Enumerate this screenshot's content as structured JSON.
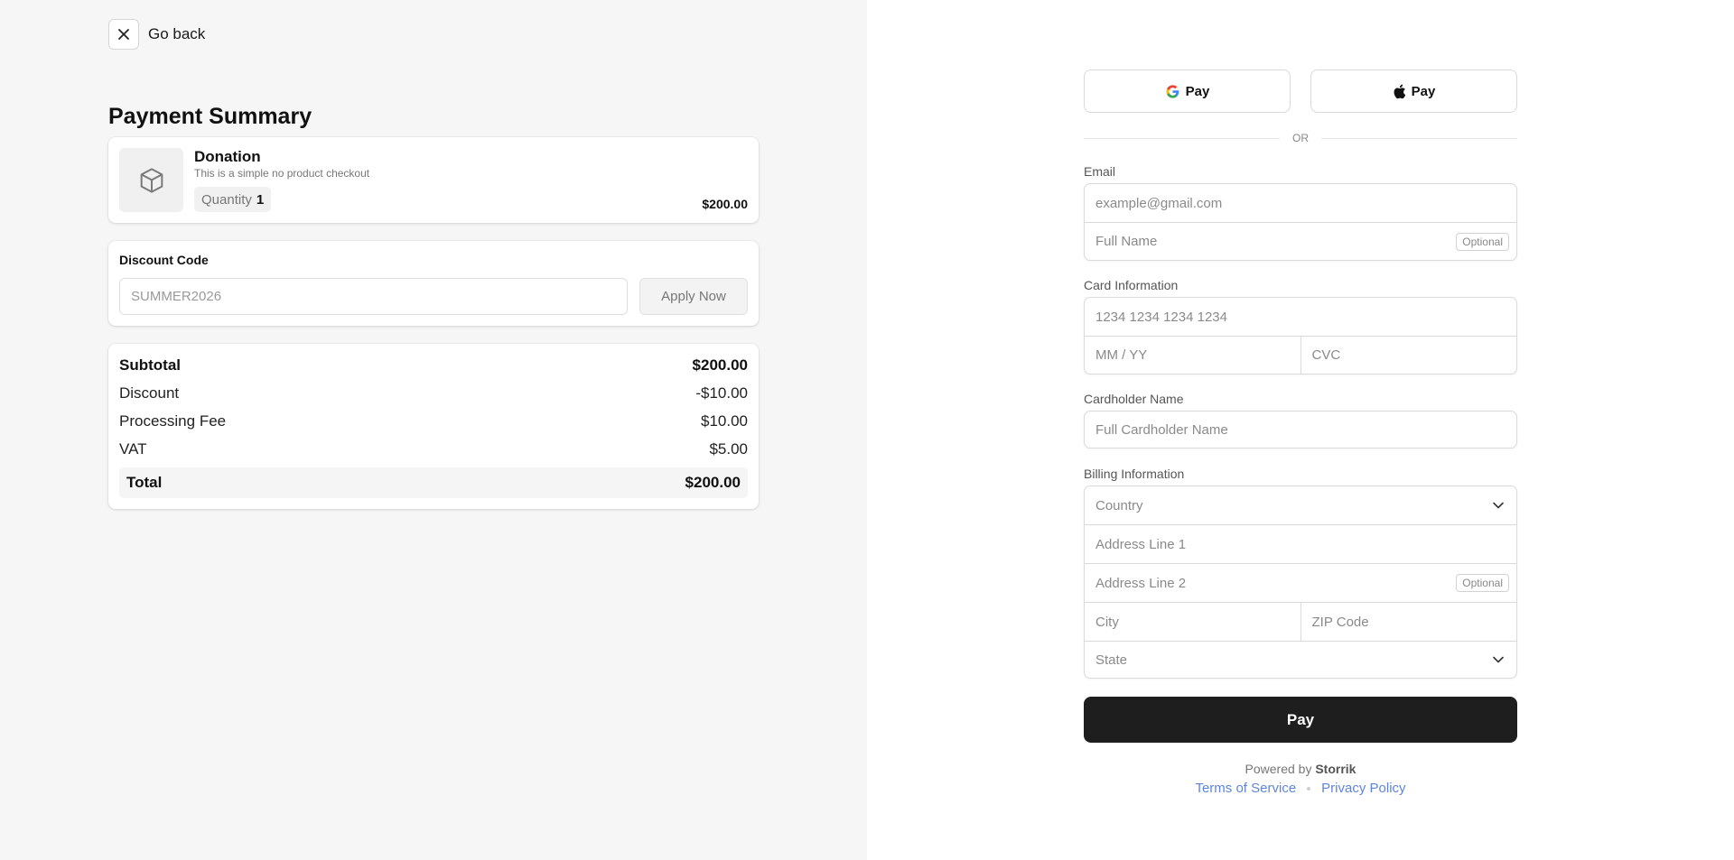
{
  "nav": {
    "go_back_label": "Go back"
  },
  "summary": {
    "title": "Payment Summary",
    "product": {
      "name": "Donation",
      "description": "This is a simple no product checkout",
      "quantity_label": "Quantity",
      "quantity_value": "1",
      "price": "$200.00"
    },
    "discount": {
      "title": "Discount Code",
      "placeholder": "SUMMER2026",
      "apply_label": "Apply Now"
    },
    "totals": {
      "rows": [
        {
          "label": "Subtotal",
          "value": "$200.00"
        },
        {
          "label": "Discount",
          "value": "-$10.00"
        },
        {
          "label": "Processing Fee",
          "value": "$10.00"
        },
        {
          "label": "VAT",
          "value": "$5.00"
        }
      ],
      "total_label": "Total",
      "total_value": "$200.00"
    }
  },
  "payment": {
    "google_pay_label": "Pay",
    "apple_pay_label": "Pay",
    "or_text": "OR",
    "email": {
      "label": "Email",
      "placeholder": "example@gmail.com"
    },
    "full_name": {
      "placeholder": "Full Name",
      "badge": "Optional"
    },
    "card": {
      "label": "Card Information",
      "number_placeholder": "1234 1234 1234 1234",
      "expiry_placeholder": "MM / YY",
      "cvc_placeholder": "CVC"
    },
    "cardholder": {
      "label": "Cardholder Name",
      "placeholder": "Full Cardholder Name"
    },
    "billing": {
      "label": "Billing Information",
      "country": "Country",
      "address1": "Address Line 1",
      "address2": "Address Line 2",
      "address2_badge": "Optional",
      "city": "City",
      "zip": "ZIP Code",
      "state": "State"
    },
    "pay_button": "Pay",
    "powered_prefix": "Powered by",
    "powered_brand": "Storrik",
    "terms_label": "Terms of Service",
    "privacy_label": "Privacy Policy"
  },
  "colors": {
    "left_background": "#f6f6f6",
    "pay_button": "#1e1e1e",
    "link": "#5f86d6"
  },
  "icons": {
    "close": "close-icon",
    "product": "package-icon",
    "google": "google-icon",
    "apple": "apple-icon",
    "chevron": "chevron-down-icon"
  }
}
